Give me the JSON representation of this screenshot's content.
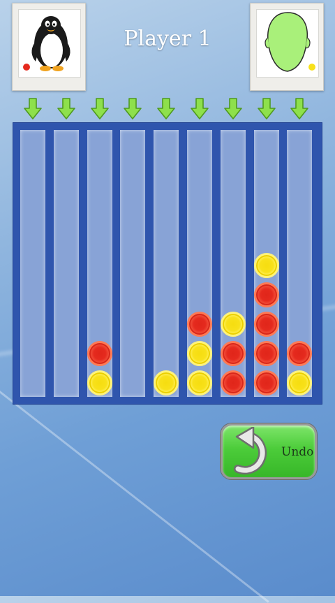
{
  "header": {
    "current_player_label": "Player 1"
  },
  "players": [
    {
      "id": "player1",
      "avatar": "penguin-icon",
      "disc_color": "red",
      "color_hex": "#e52a1e"
    },
    {
      "id": "player2",
      "avatar": "green-head-icon",
      "disc_color": "yellow",
      "color_hex": "#f8e11a"
    }
  ],
  "board": {
    "columns": 9,
    "rows": 9,
    "frame_color": "#2f55ad",
    "column_stacks_bottom_up": [
      [],
      [],
      [
        "yellow",
        "red"
      ],
      [],
      [
        "yellow"
      ],
      [
        "yellow",
        "yellow",
        "red"
      ],
      [
        "red",
        "red",
        "yellow"
      ],
      [
        "red",
        "red",
        "red",
        "red",
        "yellow"
      ],
      [
        "yellow",
        "red"
      ]
    ]
  },
  "drop_arrow_icon": "down-arrow-icon",
  "controls": {
    "undo_label": "Undo",
    "undo_icon": "undo-arrow-icon"
  }
}
